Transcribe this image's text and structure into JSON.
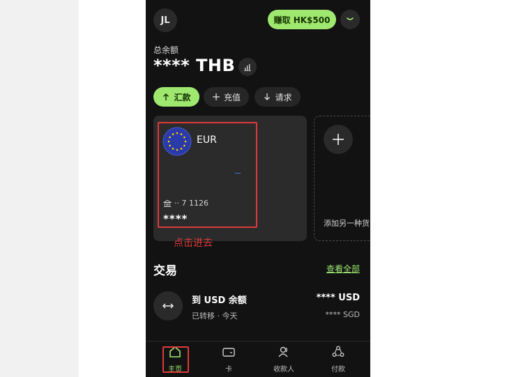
{
  "header": {
    "avatar_initials": "JL",
    "earn_label": "赚取 HK$500"
  },
  "balance": {
    "label": "总余额",
    "amount": "**** THB"
  },
  "actions": {
    "send": "汇款",
    "add": "充值",
    "request": "请求"
  },
  "eur_card": {
    "currency": "EUR",
    "account": "·· 7 1126",
    "balance": "****"
  },
  "add_card": {
    "label": "添加另一种货币"
  },
  "annotation": "点击进去",
  "transactions": {
    "title": "交易",
    "see_all": "查看全部",
    "items": [
      {
        "name": "到 USD 余额",
        "sub": "已转移 · 今天",
        "amount": "**** USD",
        "amount_secondary": "**** SGD"
      }
    ]
  },
  "nav": {
    "home": "主页",
    "card": "卡",
    "recipients": "收款人",
    "payments": "付款"
  },
  "colors": {
    "accent": "#9fe870",
    "highlight": "#e03a3a",
    "background": "#121212"
  }
}
